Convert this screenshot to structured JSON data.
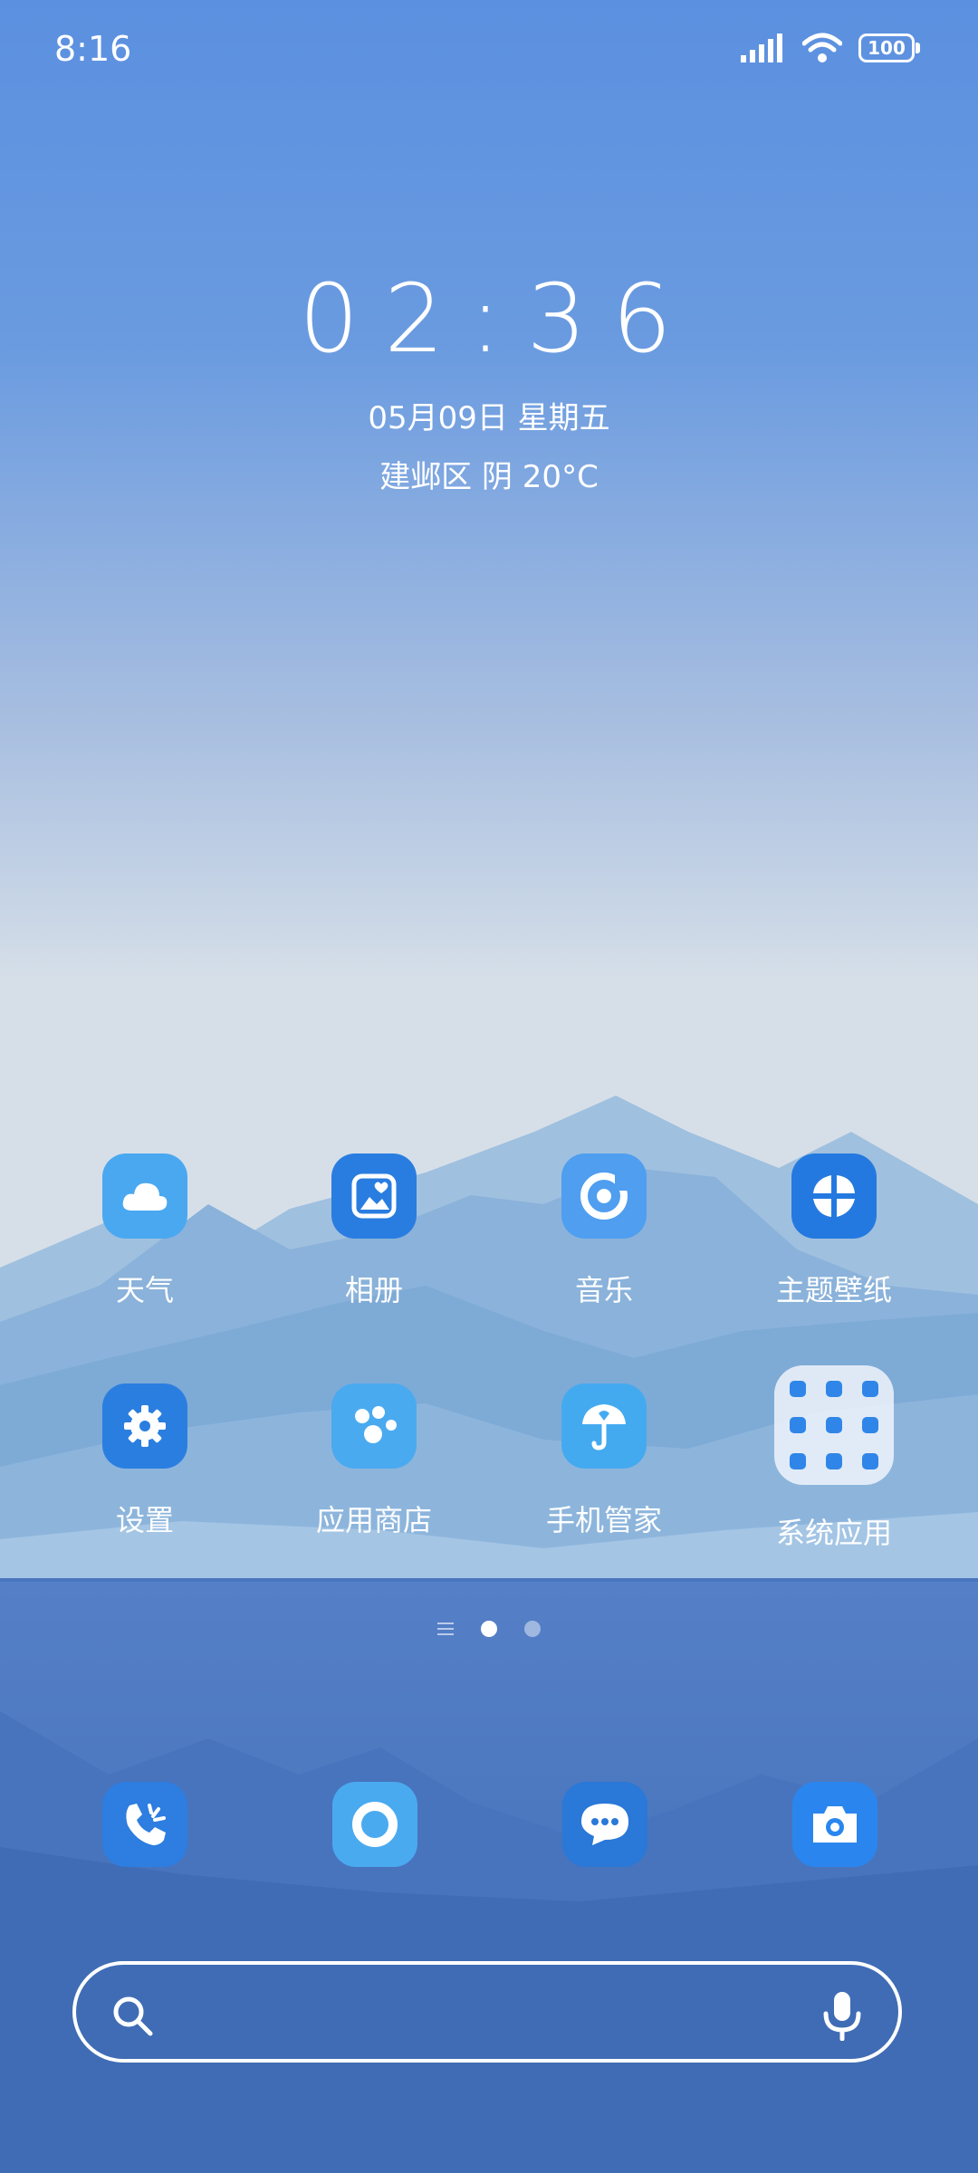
{
  "status_bar": {
    "time": "8:16",
    "battery": "100"
  },
  "clock_widget": {
    "time": "02:36",
    "date": "05月09日 星期五",
    "weather": "建邺区 阴 20°C"
  },
  "apps": [
    {
      "label": "天气",
      "icon": "cloud-icon",
      "color": "#4aa8f0"
    },
    {
      "label": "相册",
      "icon": "gallery-icon",
      "color": "#2a7de0"
    },
    {
      "label": "音乐",
      "icon": "music-icon",
      "color": "#4f9ef0"
    },
    {
      "label": "主题壁纸",
      "icon": "theme-icon",
      "color": "#2479e0"
    },
    {
      "label": "设置",
      "icon": "gear-icon",
      "color": "#2a7ee0"
    },
    {
      "label": "应用商店",
      "icon": "app-store-icon",
      "color": "#4aaaf0"
    },
    {
      "label": "手机管家",
      "icon": "umbrella-icon",
      "color": "#44aaf0"
    },
    {
      "label": "系统应用",
      "icon": "folder-icon",
      "color": "#f0f5fc"
    }
  ],
  "dock": [
    {
      "icon": "phone-icon",
      "color": "#2e7de0"
    },
    {
      "icon": "browser-icon",
      "color": "#4aaaf0"
    },
    {
      "icon": "messages-icon",
      "color": "#2a78d8"
    },
    {
      "icon": "camera-icon",
      "color": "#2a86ee"
    }
  ],
  "search_bar": {
    "placeholder": ""
  }
}
